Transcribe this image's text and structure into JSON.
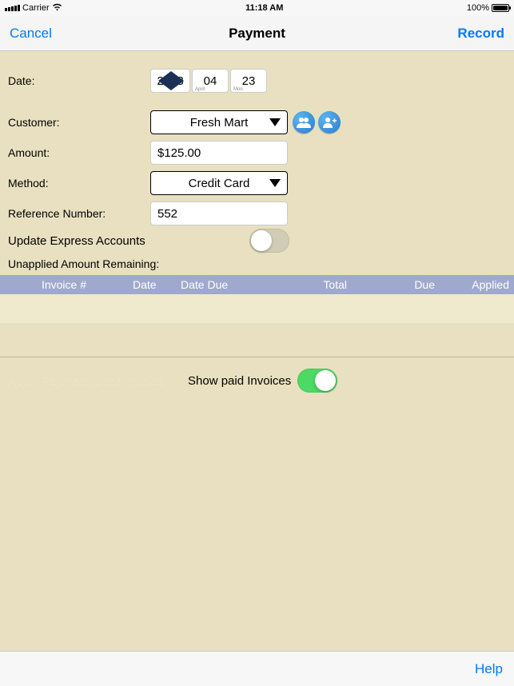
{
  "status": {
    "carrier": "Carrier",
    "time": "11:18 AM",
    "battery_pct": "100%"
  },
  "nav": {
    "cancel": "Cancel",
    "title": "Payment",
    "record": "Record"
  },
  "form": {
    "date_label": "Date:",
    "date": {
      "year": "2018",
      "month": "04",
      "month_name": "April",
      "day": "23",
      "day_name": "Mon"
    },
    "customer_label": "Customer:",
    "customer_value": "Fresh Mart",
    "amount_label": "Amount:",
    "amount_value": "$125.00",
    "method_label": "Method:",
    "method_value": "Credit Card",
    "reference_label": "Reference Number:",
    "reference_value": "552",
    "express_label": "Update Express Accounts",
    "unapplied_label": "Unapplied Amount Remaining:"
  },
  "table": {
    "headers": {
      "invoice": "Invoice #",
      "date": "Date",
      "date_due": "Date Due",
      "total": "Total",
      "due": "Due",
      "applied": "Applied"
    }
  },
  "below": {
    "apply_link": "Apply Payment to the Invoice",
    "show_paid": "Show paid Invoices"
  },
  "bottom": {
    "help": "Help"
  },
  "icons": {
    "contacts": "contacts-icon",
    "add_contact": "add-contact-icon",
    "wifi": "wifi-icon"
  }
}
